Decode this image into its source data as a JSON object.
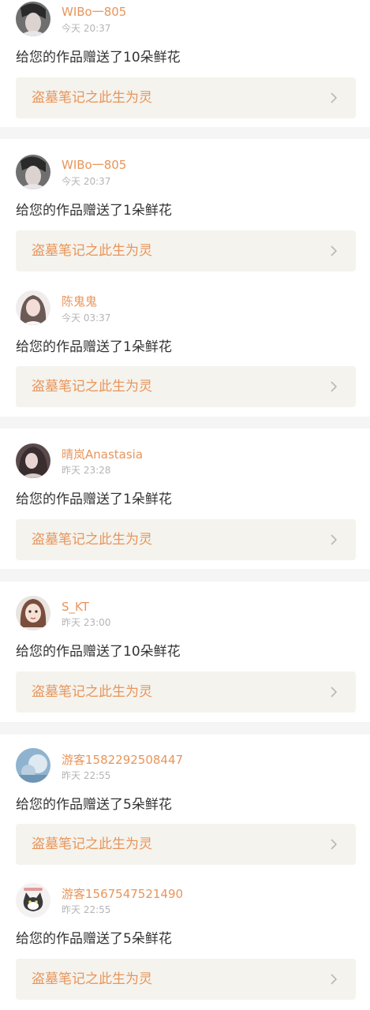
{
  "colors": {
    "accent": "#e8955a",
    "link_bg": "#f4f3ee",
    "text": "#333333",
    "muted": "#b5b5b5",
    "divider": "#f5f5f5"
  },
  "notifications": [
    {
      "username": "WIBo一805",
      "time": "今天 20:37",
      "message": "给您的作品赠送了10朵鲜花",
      "work_title": "盗墓笔记之此生为灵",
      "avatar_icon": "avatar-male-gray-icon"
    },
    {
      "username": "WIBo一805",
      "time": "今天 20:37",
      "message": "给您的作品赠送了1朵鲜花",
      "work_title": "盗墓笔记之此生为灵",
      "avatar_icon": "avatar-male-gray-icon"
    },
    {
      "username": "陈鬼鬼",
      "time": "今天 03:37",
      "message": "给您的作品赠送了1朵鲜花",
      "work_title": "盗墓笔记之此生为灵",
      "avatar_icon": "avatar-girl-light-icon"
    },
    {
      "username": "晴岚Anastasia",
      "time": "昨天 23:28",
      "message": "给您的作品赠送了1朵鲜花",
      "work_title": "盗墓笔记之此生为灵",
      "avatar_icon": "avatar-girl-dark-icon"
    },
    {
      "username": "S_KT",
      "time": "昨天 23:00",
      "message": "给您的作品赠送了10朵鲜花",
      "work_title": "盗墓笔记之此生为灵",
      "avatar_icon": "avatar-doll-icon"
    },
    {
      "username": "游客1582292508447",
      "time": "昨天 22:55",
      "message": "给您的作品赠送了5朵鲜花",
      "work_title": "盗墓笔记之此生为灵",
      "avatar_icon": "avatar-blue-blur-icon"
    },
    {
      "username": "游客1567547521490",
      "time": "昨天 22:55",
      "message": "给您的作品赠送了5朵鲜花",
      "work_title": "盗墓笔记之此生为灵",
      "avatar_icon": "avatar-cat-icon"
    }
  ]
}
